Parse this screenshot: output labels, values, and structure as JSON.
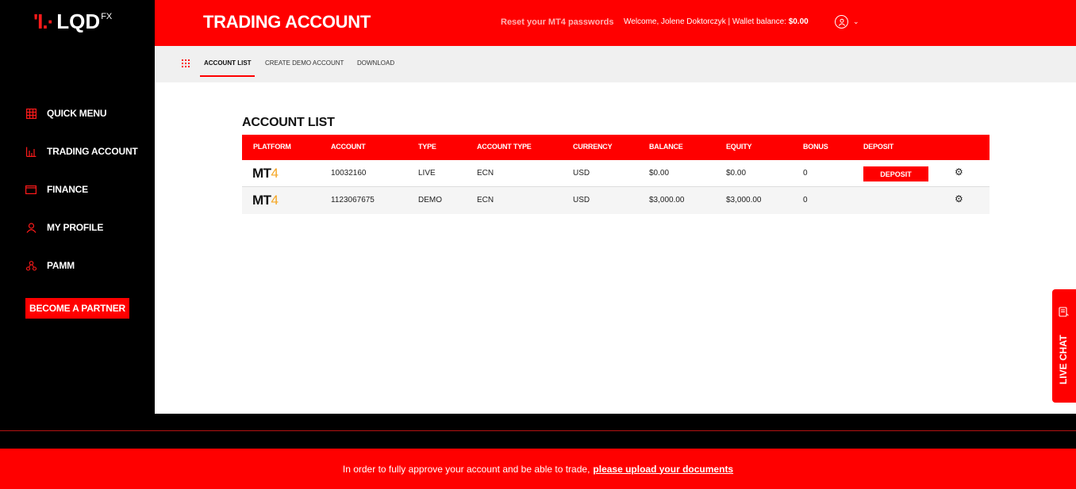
{
  "brand": {
    "mark": "'I.·",
    "name": "LQD",
    "sup": "FX"
  },
  "sidebar": {
    "items": [
      {
        "label": "QUICK MENU",
        "icon": "grid-icon"
      },
      {
        "label": "TRADING ACCOUNT",
        "icon": "bar-chart-icon"
      },
      {
        "label": "FINANCE",
        "icon": "wallet-icon"
      },
      {
        "label": "MY PROFILE",
        "icon": "user-icon"
      },
      {
        "label": "PAMM",
        "icon": "users-network-icon"
      }
    ],
    "partner_button": "BECOME A PARTNER"
  },
  "header": {
    "title": "TRADING ACCOUNT",
    "reset_link": "Reset your MT4 passwords",
    "welcome_prefix": "Welcome, Jolene Doktorczyk | Wallet balance:",
    "wallet_balance": "$0.00"
  },
  "subnav": {
    "tabs": [
      {
        "label": "ACCOUNT LIST",
        "active": true
      },
      {
        "label": "CREATE DEMO ACCOUNT",
        "active": false
      },
      {
        "label": "DOWNLOAD",
        "active": false
      }
    ]
  },
  "main": {
    "section_title": "ACCOUNT LIST",
    "columns": [
      "PLATFORM",
      "ACCOUNT",
      "TYPE",
      "ACCOUNT TYPE",
      "CURRENCY",
      "BALANCE",
      "EQUITY",
      "BONUS",
      "DEPOSIT"
    ],
    "rows": [
      {
        "platform_a": "MT",
        "platform_b": "4",
        "account": "10032160",
        "type": "LIVE",
        "account_type": "ECN",
        "currency": "USD",
        "balance": "$0.00",
        "equity": "$0.00",
        "bonus": "0",
        "deposit_label": "DEPOSIT"
      },
      {
        "platform_a": "MT",
        "platform_b": "4",
        "account": "1123067675",
        "type": "DEMO",
        "account_type": "ECN",
        "currency": "USD",
        "balance": "$3,000.00",
        "equity": "$3,000.00",
        "bonus": "0",
        "deposit_label": ""
      }
    ]
  },
  "live_chat": {
    "label": "LIVE CHAT"
  },
  "notice": {
    "text": "In order to fully approve your account and be able to trade,",
    "link": "please upload your documents"
  },
  "colors": {
    "accent": "#ff0000",
    "sidebar_bg": "#000000",
    "mt4_four": "#f5a623"
  }
}
